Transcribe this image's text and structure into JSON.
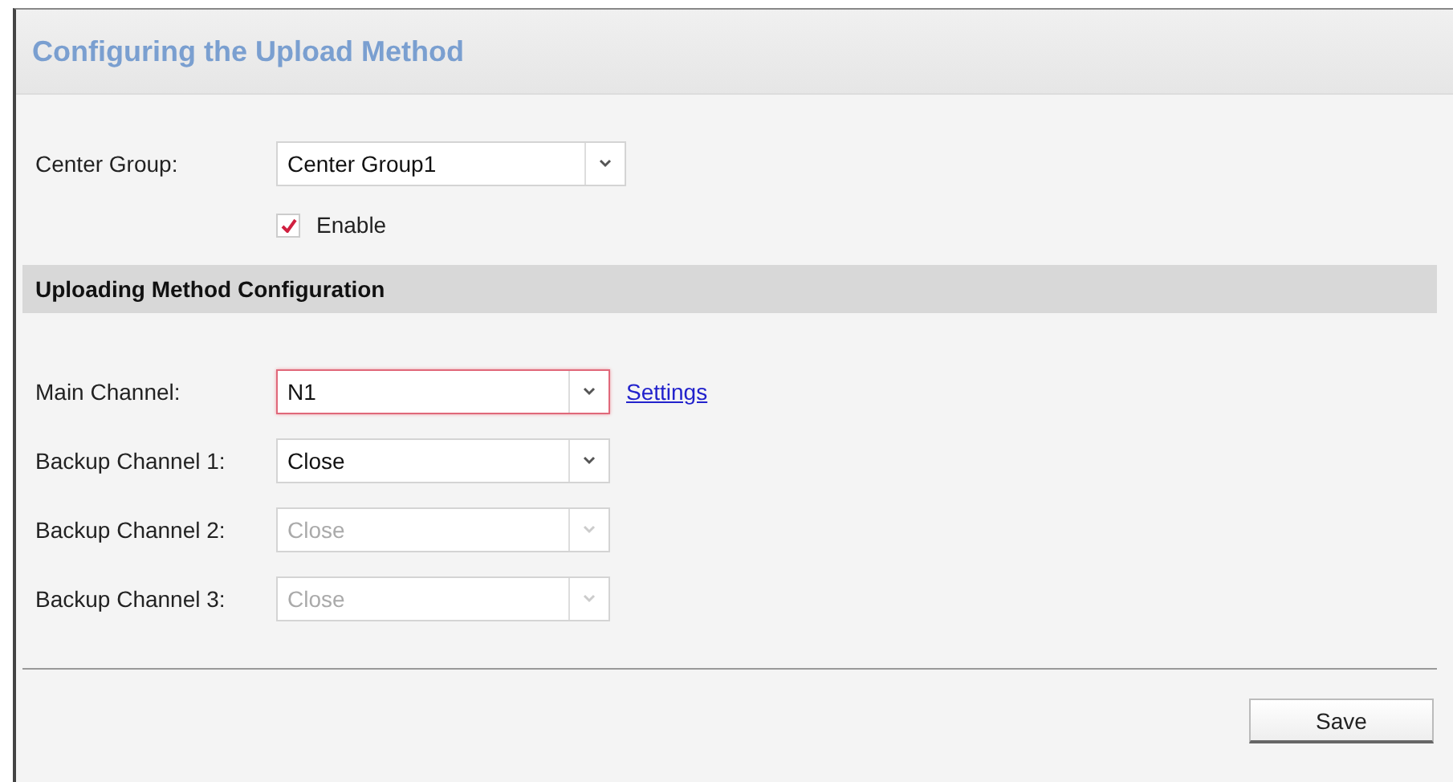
{
  "panel": {
    "title": "Configuring the Upload Method"
  },
  "center_group": {
    "label": "Center Group:",
    "value": "Center Group1"
  },
  "enable": {
    "label": "Enable",
    "checked": true
  },
  "section": {
    "title": "Uploading Method Configuration"
  },
  "channels": [
    {
      "label": "Main Channel:",
      "value": "N1",
      "disabled": false,
      "highlighted": true,
      "link": "Settings"
    },
    {
      "label": "Backup Channel 1:",
      "value": "Close",
      "disabled": false,
      "highlighted": false
    },
    {
      "label": "Backup Channel 2:",
      "value": "Close",
      "disabled": true,
      "highlighted": false
    },
    {
      "label": "Backup Channel 3:",
      "value": "Close",
      "disabled": true,
      "highlighted": false
    }
  ],
  "buttons": {
    "save": "Save"
  }
}
